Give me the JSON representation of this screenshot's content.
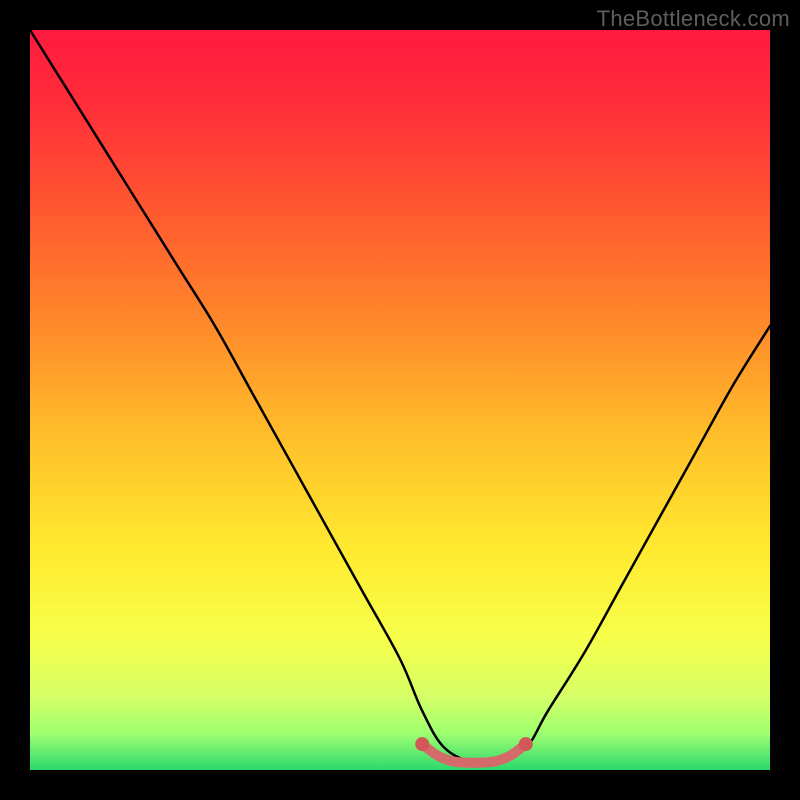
{
  "watermark": "TheBottleneck.com",
  "chart_data": {
    "type": "line",
    "title": "",
    "xlabel": "",
    "ylabel": "",
    "xlim": [
      0,
      100
    ],
    "ylim": [
      0,
      100
    ],
    "series": [
      {
        "name": "bottleneck-curve",
        "x": [
          0,
          5,
          10,
          15,
          20,
          25,
          30,
          35,
          40,
          45,
          50,
          53,
          56,
          60,
          63,
          67,
          70,
          75,
          80,
          85,
          90,
          95,
          100
        ],
        "y": [
          100,
          92,
          84,
          76,
          68,
          60,
          51,
          42,
          33,
          24,
          15,
          8,
          3,
          1,
          1,
          3,
          8,
          16,
          25,
          34,
          43,
          52,
          60
        ]
      },
      {
        "name": "optimal-band",
        "x": [
          53,
          55,
          57,
          59,
          61,
          63,
          65,
          67
        ],
        "y": [
          3.5,
          2,
          1.2,
          1,
          1,
          1.2,
          2,
          3.5
        ]
      }
    ],
    "gradient_stops": [
      {
        "offset": 0.0,
        "color": "#ff1a3f"
      },
      {
        "offset": 0.1,
        "color": "#ff2d3a"
      },
      {
        "offset": 0.25,
        "color": "#ff5a2f"
      },
      {
        "offset": 0.4,
        "color": "#ff8a2a"
      },
      {
        "offset": 0.55,
        "color": "#ffbf2a"
      },
      {
        "offset": 0.7,
        "color": "#ffe92f"
      },
      {
        "offset": 0.82,
        "color": "#f7ff4a"
      },
      {
        "offset": 0.9,
        "color": "#d6ff66"
      },
      {
        "offset": 0.95,
        "color": "#9fff70"
      },
      {
        "offset": 1.0,
        "color": "#2bd96d"
      }
    ],
    "colors": {
      "curve": "#000000",
      "band": "#d46a6a",
      "band_dot": "#d05858"
    }
  }
}
